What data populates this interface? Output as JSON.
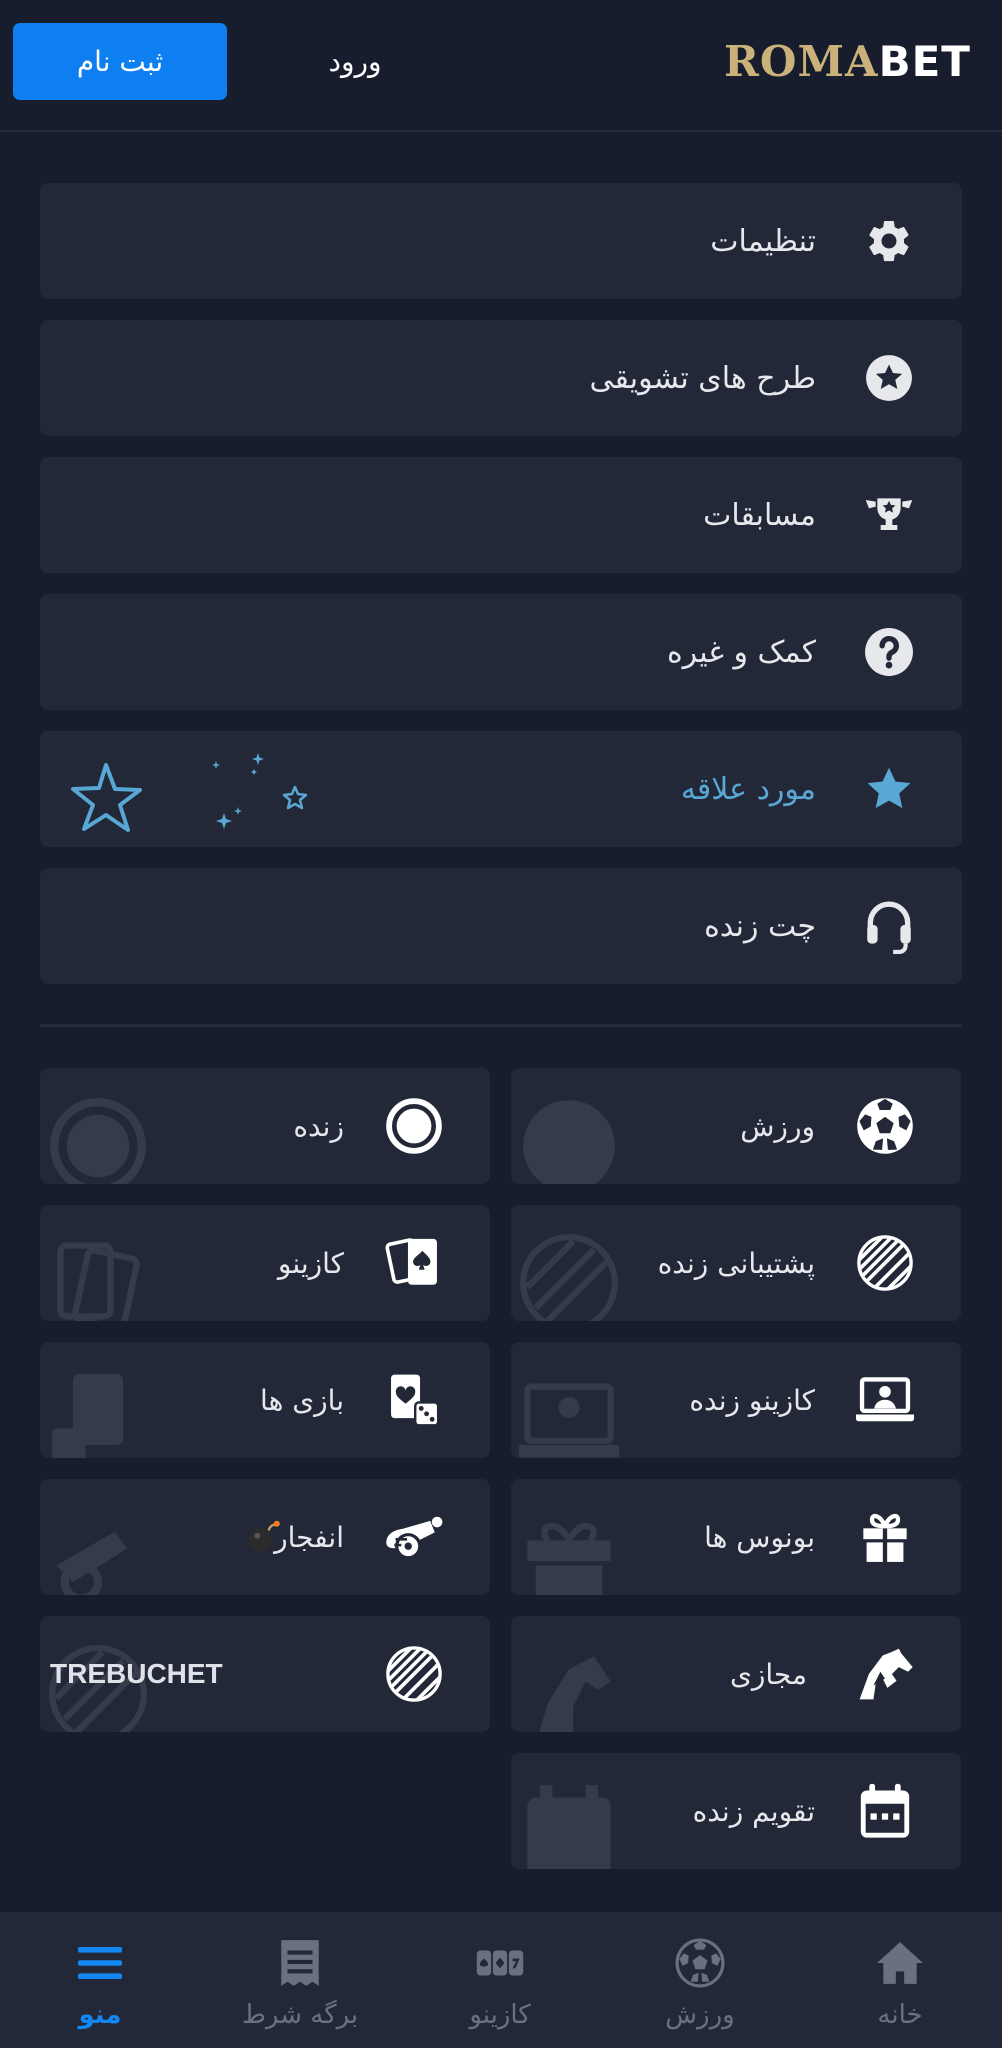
{
  "header": {
    "register_label": "ثبت نام",
    "login_label": "ورود",
    "logo_left": "ROMA",
    "logo_right": "BET"
  },
  "menu_items": [
    {
      "label": "تنظیمات",
      "icon": "gear-icon"
    },
    {
      "label": "طرح های تشویقی",
      "icon": "star-circle-icon"
    },
    {
      "label": "مسابقات",
      "icon": "trophy-icon"
    },
    {
      "label": "کمک و غیره",
      "icon": "question-icon"
    },
    {
      "label": "مورد علاقه",
      "icon": "star-icon"
    },
    {
      "label": "چت زنده",
      "icon": "headset-icon"
    }
  ],
  "tiles": [
    {
      "label": "ورزش",
      "icon": "soccer-ball-icon"
    },
    {
      "label": "زنده",
      "icon": "live-record-icon"
    },
    {
      "label": "پشتیبانی زنده",
      "icon": "striped-circle-icon"
    },
    {
      "label": "کازینو",
      "icon": "playing-cards-icon"
    },
    {
      "label": "کازینو زنده",
      "icon": "laptop-dealer-icon"
    },
    {
      "label": "بازی ها",
      "icon": "card-dice-icon"
    },
    {
      "label": "بونوس ها",
      "icon": "gift-icon"
    },
    {
      "label": "انفجار",
      "icon": "cannon-icon"
    },
    {
      "label": "مجازی",
      "icon": "horse-icon"
    },
    {
      "label": "TREBUCHET",
      "icon": "striped-circle-icon"
    },
    {
      "label": "تقویم زنده",
      "icon": "calendar-icon"
    }
  ],
  "bottom_nav": [
    {
      "label": "منو",
      "icon": "menu-icon",
      "active": true
    },
    {
      "label": "برگه شرط",
      "icon": "receipt-icon",
      "active": false
    },
    {
      "label": "کازینو",
      "icon": "slot-icon",
      "active": false
    },
    {
      "label": "ورزش",
      "icon": "soccer-ball-icon",
      "active": false
    },
    {
      "label": "خانه",
      "icon": "home-icon",
      "active": false
    }
  ],
  "colors": {
    "background": "#171d2d",
    "card": "#222837",
    "primary": "#0d7ff0",
    "favorite": "#58a7d4",
    "logo_gold": "#cbb27a"
  }
}
